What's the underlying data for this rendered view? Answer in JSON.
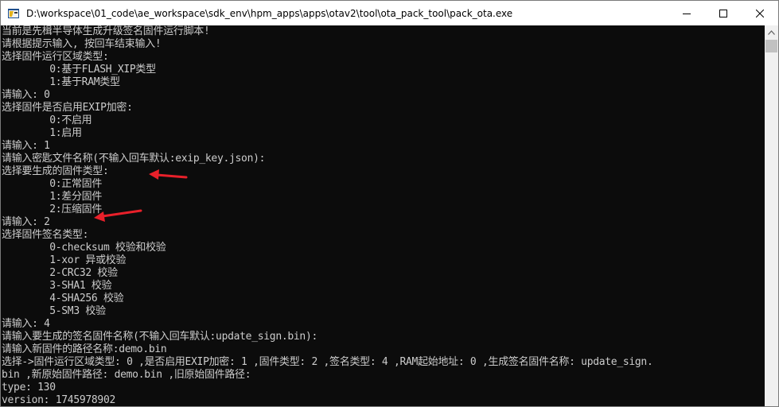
{
  "window": {
    "title": "D:\\workspace\\01_code\\ae_workspace\\sdk_env\\hpm_apps\\apps\\otav2\\tool\\ota_pack_tool\\pack_ota.exe",
    "icons": {
      "app": "console-app-icon",
      "minimize": "minimize-icon",
      "maximize": "maximize-icon",
      "close": "close-icon",
      "scroll_up": "chevron-up-icon"
    }
  },
  "console": {
    "lines": [
      "当前是先楫半导体生成升级签名固件运行脚本!",
      "请根据提示输入, 按回车结束输入!",
      "选择固件运行区域类型:",
      "        0:基于FLASH_XIP类型",
      "        1:基于RAM类型",
      "请输入: 0",
      "选择固件是否启用EXIP加密:",
      "        0:不启用",
      "        1:启用",
      "请输入: 1",
      "请输入密匙文件名称(不输入回车默认:exip_key.json):",
      "选择要生成的固件类型:",
      "        0:正常固件",
      "        1:差分固件",
      "        2:压缩固件",
      "请输入: 2",
      "选择固件签名类型:",
      "        0-checksum 校验和校验",
      "        1-xor 异或校验",
      "        2-CRC32 校验",
      "        3-SHA1 校验",
      "        4-SHA256 校验",
      "        5-SM3 校验",
      "请输入: 4",
      "请输入要生成的签名固件名称(不输入回车默认:update_sign.bin):",
      "请输入新固件的路径名称:demo.bin",
      "选择->固件运行区域类型: 0 ,是否启用EXIP加密: 1 ,固件类型: 2 ,签名类型: 4 ,RAM起始地址: 0 ,生成签名固件名称: update_sign.",
      "bin ,新原始固件路径: demo.bin ,旧原始固件路径:",
      "type: 130",
      "version: 1745978902"
    ]
  },
  "colors": {
    "console_bg": "#0c0c0c",
    "console_text": "#cccccc",
    "titlebar_bg": "#ffffff",
    "annotation_arrow": "#e8202a"
  }
}
